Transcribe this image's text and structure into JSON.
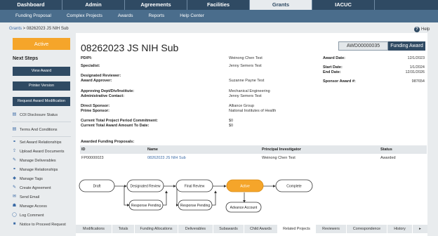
{
  "topnav": [
    "Dashboard",
    "Admin",
    "Agreements",
    "Facilities",
    "Grants",
    "IACUC"
  ],
  "topnav_active": "Grants",
  "subnav": [
    "Funding Proposal",
    "Complex Projects",
    "Awards",
    "Reports",
    "Help Center"
  ],
  "breadcrumb": {
    "root": "Grants",
    "sep": " > ",
    "current": "08262023 JS NIH Sub"
  },
  "help_label": "Help",
  "sidebar": {
    "status": "Active",
    "next_steps_title": "Next Steps",
    "buttons": [
      "View Award",
      "Printer Version",
      "Request Award Modification"
    ],
    "links": [
      {
        "icon": "coi-icon",
        "glyph": "▤",
        "label": "COI Disclosure Status"
      },
      {
        "icon": "terms-icon",
        "glyph": "▤",
        "label": "Terms And Conditions"
      },
      {
        "icon": "relationship-icon",
        "glyph": "⚭",
        "label": "Set Award Relationships"
      },
      {
        "icon": "upload-icon",
        "glyph": "⇪",
        "label": "Upload Award Documents"
      },
      {
        "icon": "edit-icon",
        "glyph": "✎",
        "label": "Manage Deliverables"
      },
      {
        "icon": "relationship-icon",
        "glyph": "⚭",
        "label": "Manage Relationships"
      },
      {
        "icon": "tag-icon",
        "glyph": "◆",
        "label": "Manage Tags"
      },
      {
        "icon": "edit-icon",
        "glyph": "✎",
        "label": "Create Agreement"
      },
      {
        "icon": "email-icon",
        "glyph": "✉",
        "label": "Send Email"
      },
      {
        "icon": "users-icon",
        "glyph": "☗",
        "label": "Manage Access"
      },
      {
        "icon": "comment-icon",
        "glyph": "◯",
        "label": "Log Comment"
      },
      {
        "icon": "notice-icon",
        "glyph": "■",
        "label": "Notice to Proceed Request"
      }
    ]
  },
  "main": {
    "title": "08262023 JS NIH Sub",
    "award_number": "AWD00000035",
    "funding_award_label": "Funding Award",
    "fields": {
      "pd_pi_label": "PD/PI:",
      "pd_pi": "Weinong Chen Test",
      "specialist_label": "Specialist:",
      "specialist": "Jenny Semers Test",
      "designated_reviewer_label": "Designated Reviewer:",
      "award_approver_label": "Award Approver:",
      "award_approver": "Suzanne Payne Test",
      "approving_dept_label": "Approving Dept/Div/Institute:",
      "approving_dept": "Mechanical Engineering",
      "admin_contact_label": "Administrative Contact:",
      "admin_contact": "Jenny Semers Test",
      "direct_sponsor_label": "Direct Sponsor:",
      "direct_sponsor": "Alliance Group",
      "prime_sponsor_label": "Prime Sponsor:",
      "prime_sponsor": "National Institutes of Health",
      "period_commitment_label": "Current Total Project Period Commitment:",
      "period_commitment": "$0",
      "award_amount_label": "Current Total Award Amount To Date:",
      "award_amount": "$0",
      "award_date_label": "Award Date:",
      "award_date": "12/1/2023",
      "start_date_label": "Start Date:",
      "start_date": "1/1/2024",
      "end_date_label": "End Date:",
      "end_date": "12/31/2026",
      "sponsor_award_label": "Sponsor Award #:",
      "sponsor_award": "987654"
    },
    "proposals_title": "Awarded Funding Proposals:",
    "proposals_columns": [
      "ID",
      "Name",
      "Principal Investigator",
      "Status"
    ],
    "proposals_rows": [
      [
        "FP00000023",
        "08262023 JS NIH Sub",
        "Weinong Chen Test",
        "Awarded"
      ]
    ],
    "workflow": {
      "states": [
        "Draft",
        "Designated Review",
        "Final Review",
        "Active",
        "Complete",
        "Response Pending",
        "Response Pending",
        "Advance Account"
      ],
      "current": "Active",
      "accent": "#f5a52a"
    }
  },
  "bottom_tabs": [
    "Modifications",
    "Totals",
    "Funding Allocations",
    "Deliverables",
    "Subawards",
    "Child Awards",
    "Related Projects",
    "Reviewers",
    "Correspondence",
    "History"
  ],
  "bottom_tabs_active": "Related Projects",
  "colors": {
    "nav": "#2f4a63",
    "subnav": "#4a6d8c",
    "accent": "#f5a52a",
    "link": "#3a6aa5"
  }
}
